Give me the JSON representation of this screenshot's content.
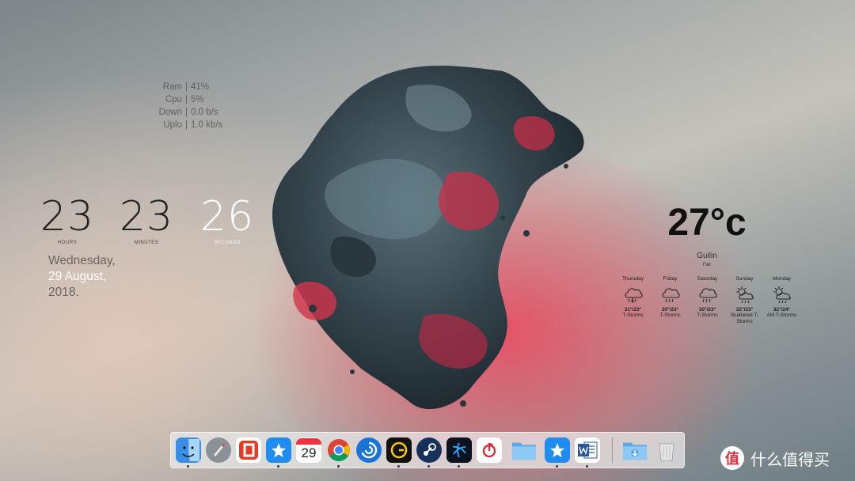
{
  "stats": [
    {
      "label": "Ram",
      "value": "41%"
    },
    {
      "label": "Cpu",
      "value": "5%"
    },
    {
      "label": "Down",
      "value": "0.0 b/s"
    },
    {
      "label": "Uplo",
      "value": "1.0 kb/s"
    }
  ],
  "stats_separator": "|",
  "clock": {
    "hours": "23",
    "hours_label": "HOURS",
    "minutes": "23",
    "minutes_label": "MINUTES",
    "seconds": "26",
    "seconds_label": "SECONDS"
  },
  "date": {
    "weekday": "Wednesday,",
    "day": "29",
    "month": "August,",
    "year": "2018."
  },
  "weather": {
    "temp": "27°c",
    "city": "Guilin",
    "condition": "Fair",
    "forecast": [
      {
        "day": "Thursday",
        "range": "31°/23°",
        "cond": "T-Storms",
        "icon": "cloud-rain-icon"
      },
      {
        "day": "Friday",
        "range": "30°/23°",
        "cond": "T-Storms",
        "icon": "cloud-rain-icon"
      },
      {
        "day": "Saturday",
        "range": "30°/23°",
        "cond": "T-Storms",
        "icon": "cloud-rain-icon"
      },
      {
        "day": "Sunday",
        "range": "32°/23°",
        "cond": "Scattered T-Storms",
        "icon": "sun-cloud-rain-icon"
      },
      {
        "day": "Monday",
        "range": "32°/24°",
        "cond": "AM T-Storms",
        "icon": "sun-cloud-rain-icon"
      }
    ]
  },
  "dock": {
    "items": [
      {
        "name": "finder-icon",
        "color": "#3a8ee6"
      },
      {
        "name": "launchpad-icon",
        "color": "#8c9097"
      },
      {
        "name": "office-icon",
        "color": "#e23b26"
      },
      {
        "name": "dingtalk-icon",
        "color": "#1e8cf0"
      },
      {
        "name": "calendar-icon",
        "color": "#ffffff",
        "text": "29"
      },
      {
        "name": "chrome-icon",
        "color": "#ffffff"
      },
      {
        "name": "uplay-icon",
        "color": "#1a74d6"
      },
      {
        "name": "game-launcher-icon",
        "color": "#111111"
      },
      {
        "name": "steam-icon",
        "color": "#17325a"
      },
      {
        "name": "battlenet-icon",
        "color": "#0b1220"
      },
      {
        "name": "netease-music-icon",
        "color": "#ffffff"
      },
      {
        "name": "folder-icon",
        "color": "#73b8ef"
      },
      {
        "name": "dingtalk-icon",
        "color": "#1e8cf0"
      },
      {
        "name": "word-icon",
        "color": "#2b579a"
      },
      {
        "name": "downloads-folder-icon",
        "color": "#73b8ef"
      },
      {
        "name": "trash-icon",
        "color": "#e6e6e6"
      }
    ]
  },
  "watermark": {
    "text": "什么值得买",
    "logo": "值"
  }
}
